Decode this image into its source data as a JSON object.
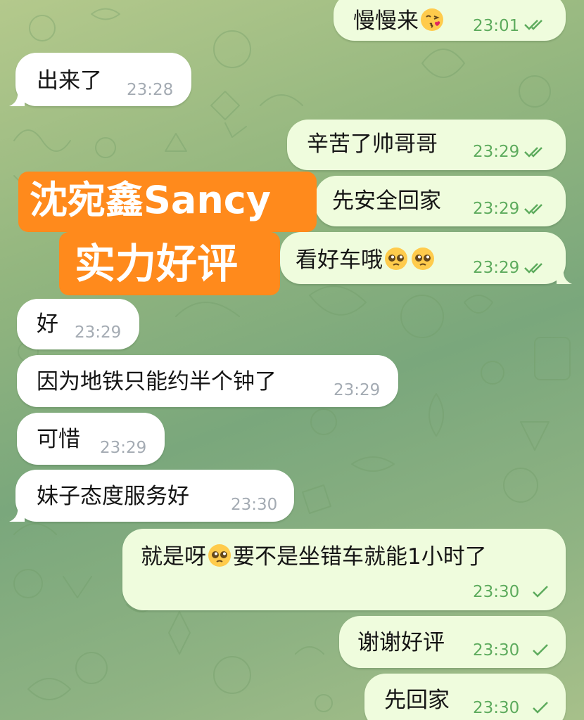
{
  "overlay": {
    "line1": "沈宛鑫Sancy",
    "line2": "实力好评",
    "color": "#ff8a1c"
  },
  "colors": {
    "incoming_bubble": "#ffffff",
    "outgoing_bubble": "#effcdd",
    "outgoing_time": "#5dab5d",
    "incoming_time": "#a4abb3"
  },
  "messages": [
    {
      "text": "慢慢来",
      "emoji_after": "kissing-heart-emoji",
      "time": "23:01",
      "direction": "out",
      "status": "read"
    },
    {
      "text": "出来了",
      "time": "23:28",
      "direction": "in"
    },
    {
      "text": "辛苦了帅哥哥",
      "time": "23:29",
      "direction": "out",
      "status": "read"
    },
    {
      "text": "先安全回家",
      "time": "23:29",
      "direction": "out",
      "status": "read"
    },
    {
      "text": "看好车哦",
      "emoji_after": "pleading-face-emoji x2",
      "time": "23:29",
      "direction": "out",
      "status": "read"
    },
    {
      "text": "好",
      "time": "23:29",
      "direction": "in"
    },
    {
      "text": "因为地铁只能约半个钟了",
      "time": "23:29",
      "direction": "in"
    },
    {
      "text": "可惜",
      "time": "23:29",
      "direction": "in"
    },
    {
      "text": "妹子态度服务好",
      "time": "23:30",
      "direction": "in"
    },
    {
      "text_before": "就是呀",
      "emoji_mid": "pleading-face-emoji",
      "text_after": "要不是坐错车就能1小时了",
      "time": "23:30",
      "direction": "out",
      "status": "sent"
    },
    {
      "text": "谢谢好评",
      "time": "23:30",
      "direction": "out",
      "status": "sent"
    },
    {
      "text": "先回家",
      "time": "23:30",
      "direction": "out",
      "status": "sent"
    }
  ]
}
